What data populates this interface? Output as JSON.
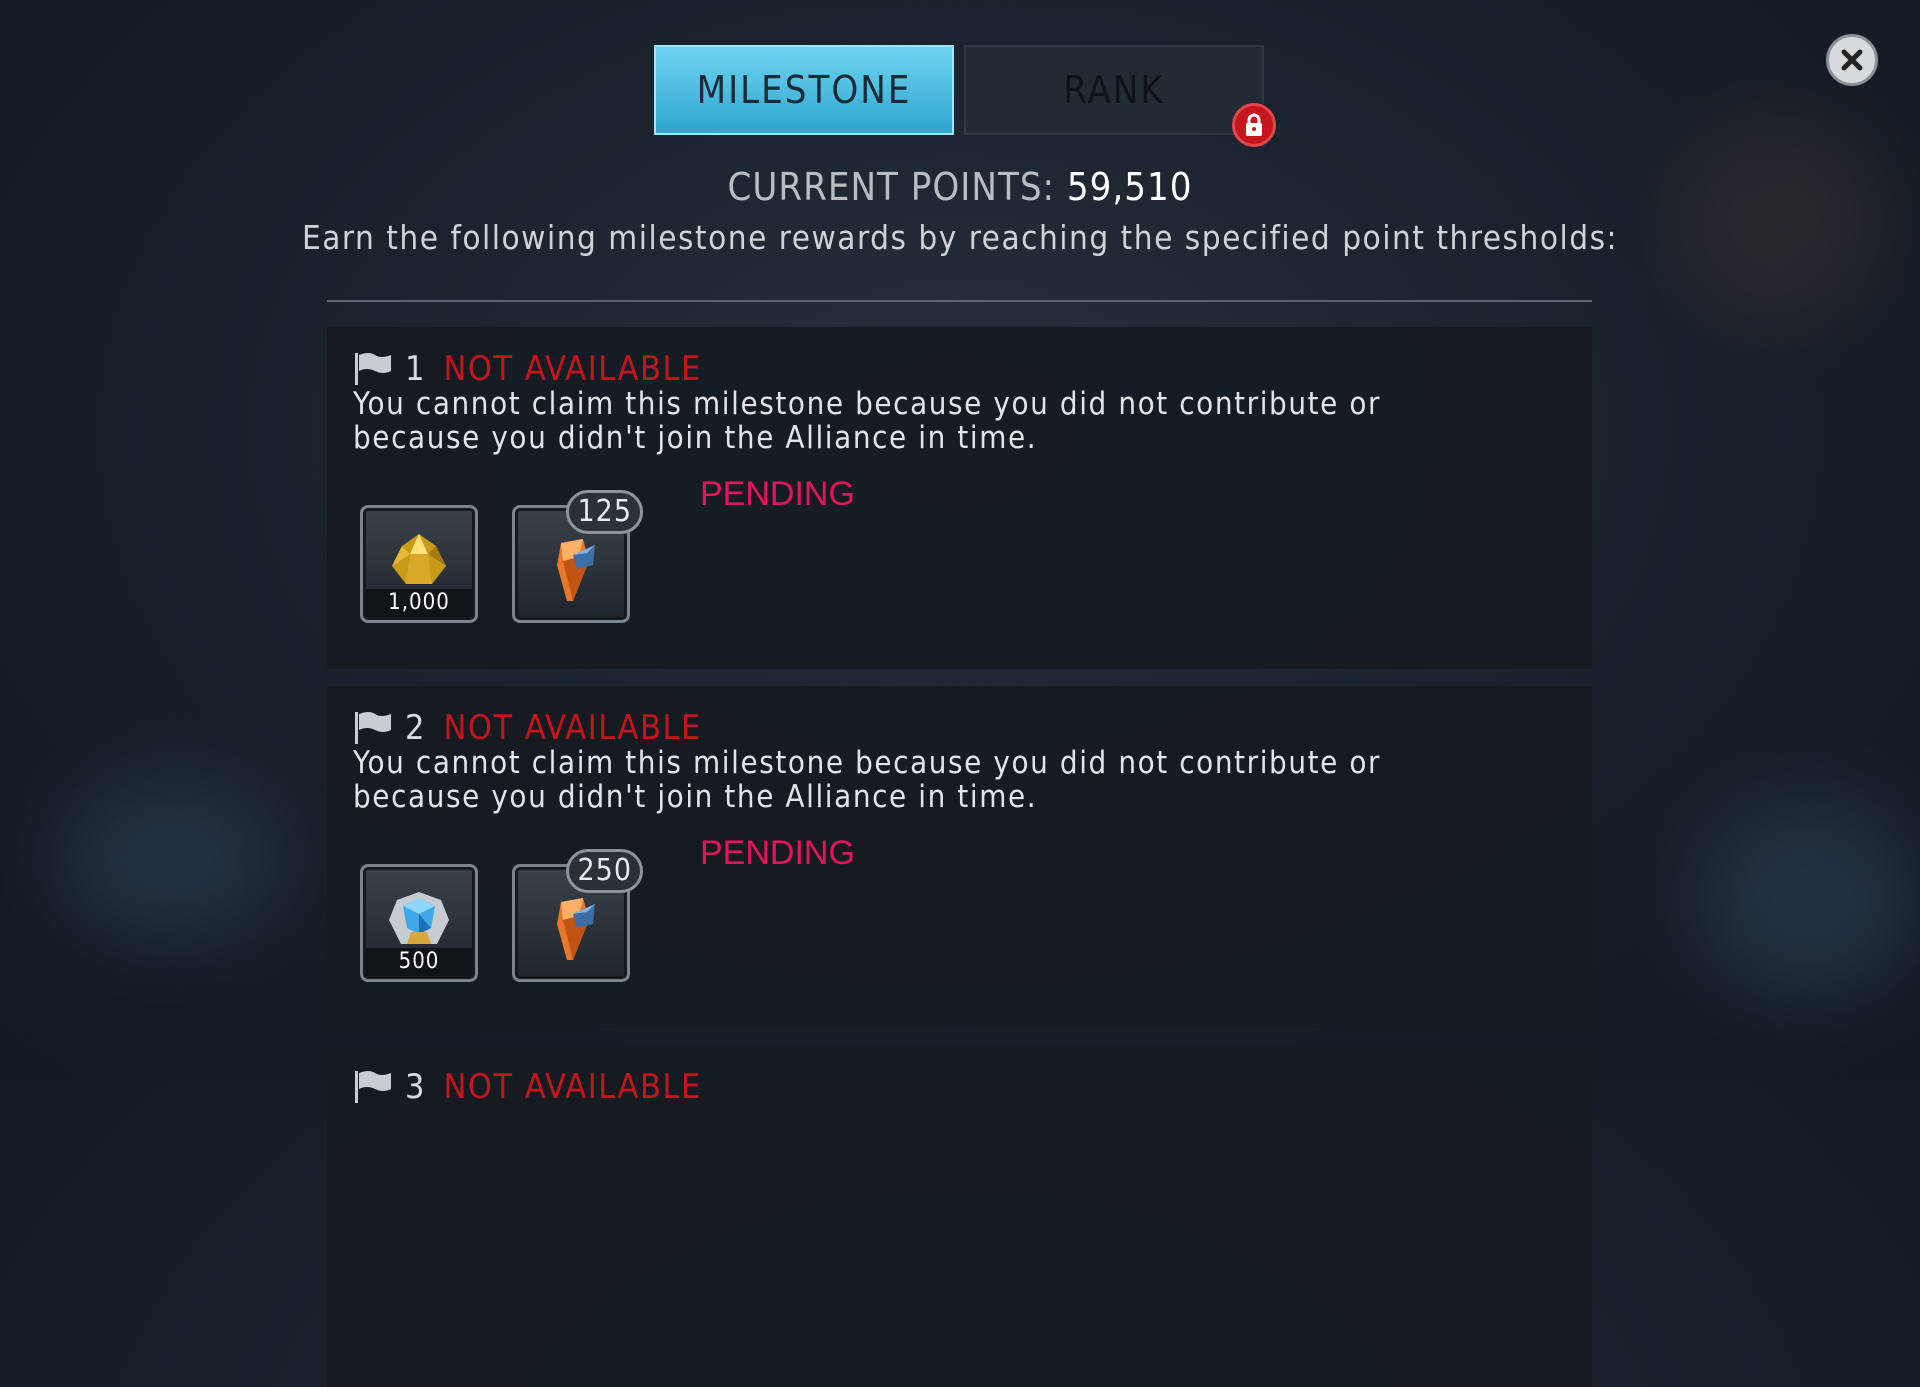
{
  "tabs": {
    "milestone": "MILESTONE",
    "rank": "RANK"
  },
  "header": {
    "points_label": "CURRENT POINTS:",
    "points_value": "59,510",
    "subtitle": "Earn the following milestone rewards by reaching the specified point thresholds:"
  },
  "milestones": [
    {
      "number": "1",
      "status": "NOT AVAILABLE",
      "description_line1": "You cannot claim this milestone because you did not contribute or",
      "description_line2": "because you didn't join the Alliance in time.",
      "pending": "PENDING",
      "reward1": {
        "icon": "gold-ore-icon",
        "qty": "1,000"
      },
      "reward2": {
        "icon": "orange-crystal-shard-icon",
        "count": "125"
      }
    },
    {
      "number": "2",
      "status": "NOT AVAILABLE",
      "description_line1": "You cannot claim this milestone because you did not contribute or",
      "description_line2": "because you didn't join the Alliance in time.",
      "pending": "PENDING",
      "reward1": {
        "icon": "blue-crystal-ore-icon",
        "qty": "500"
      },
      "reward2": {
        "icon": "orange-crystal-shard-icon",
        "count": "250"
      }
    },
    {
      "number": "3",
      "status": "NOT AVAILABLE"
    }
  ],
  "colors": {
    "tab_active": "#4bbde2",
    "status_red": "#c3161c",
    "pending_pink": "#e6145a"
  }
}
